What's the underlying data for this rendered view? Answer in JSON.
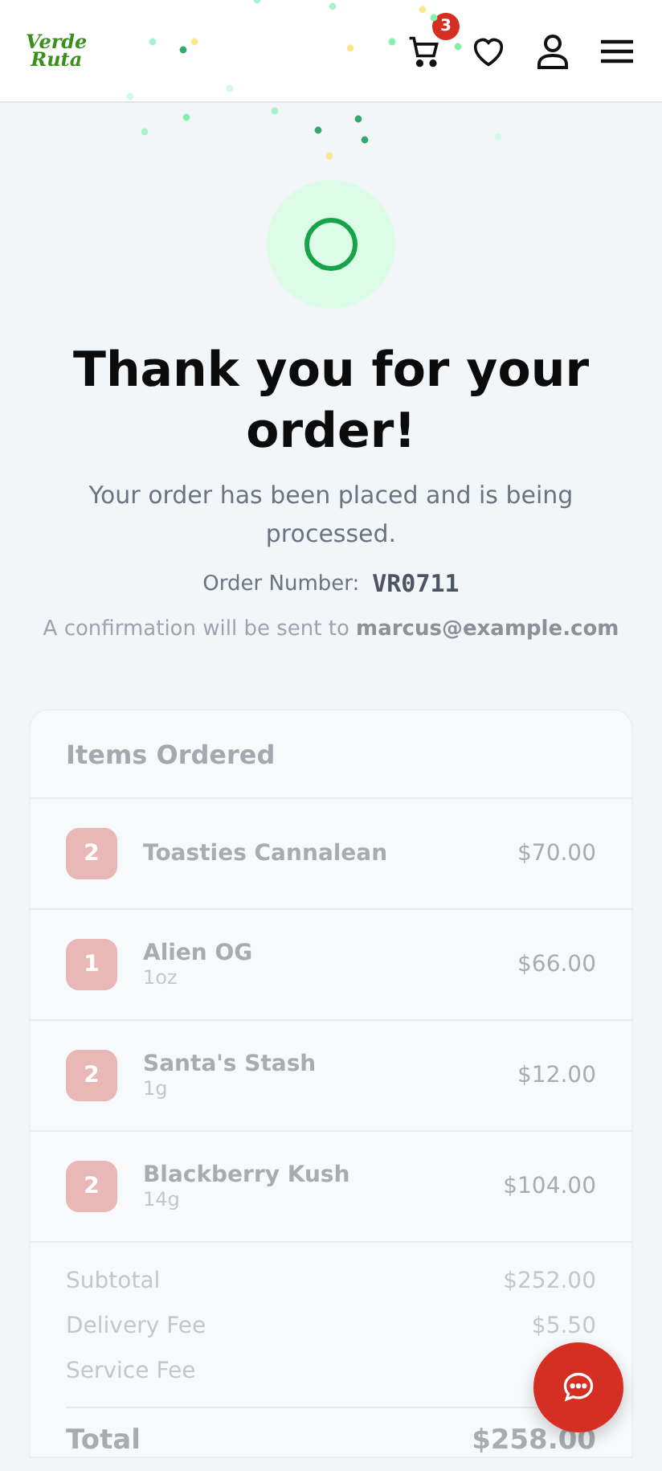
{
  "header": {
    "logo": {
      "line_1": "Verde",
      "line_2": "Ruta"
    },
    "cart_count": "3"
  },
  "confirmation": {
    "title": "Thank you for your order!",
    "message": "Your order has been placed and is being processed.",
    "order_number_label": "Order Number:",
    "order_number": "VR0711",
    "email_note": "A confirmation will be sent to **marcus@example.com**"
  },
  "items_card": {
    "title": "Items Ordered",
    "items": [
      {
        "quantity": "2",
        "name": "Toasties Cannalean",
        "price": "$70.00"
      },
      {
        "quantity": "1",
        "name": "Alien OG",
        "variant": "1oz",
        "price": "$66.00"
      },
      {
        "quantity": "2",
        "name": "Santa's Stash",
        "variant": "1g",
        "price": "$12.00"
      },
      {
        "quantity": "2",
        "name": "Blackberry Kush",
        "variant": "14g",
        "price": "$104.00"
      }
    ]
  },
  "summary": {
    "lines": [
      {
        "label": "Subtotal",
        "value": "$252.00"
      },
      {
        "label": "Delivery Fee",
        "value": "$5.50"
      },
      {
        "label": "Service Fee"
      }
    ],
    "total_label": "Total",
    "total": "$258.00"
  }
}
